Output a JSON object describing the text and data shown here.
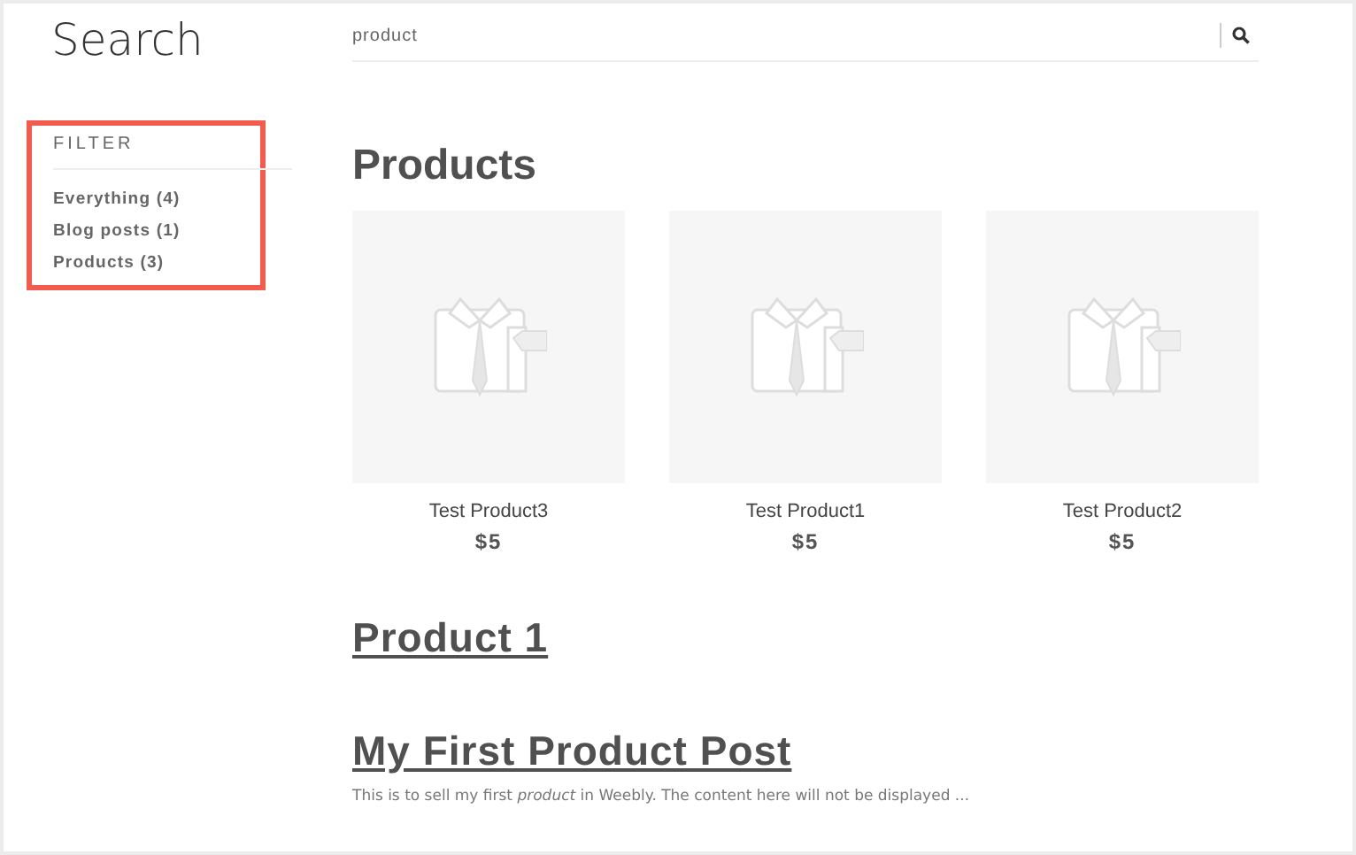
{
  "title": "Search",
  "search": {
    "value": "product"
  },
  "filter": {
    "heading": "FILTER",
    "items": [
      {
        "label": "Everything (4)"
      },
      {
        "label": "Blog posts (1)"
      },
      {
        "label": "Products (3)"
      }
    ]
  },
  "products": {
    "heading": "Products",
    "items": [
      {
        "name": "Test Product3",
        "price": "$5"
      },
      {
        "name": "Test Product1",
        "price": "$5"
      },
      {
        "name": "Test Product2",
        "price": "$5"
      }
    ]
  },
  "results": [
    {
      "title": "Product 1"
    },
    {
      "title": "My First Product Post",
      "excerpt": "This is to sell my first *product* in Weebly. The content here will not be displayed ..."
    }
  ]
}
